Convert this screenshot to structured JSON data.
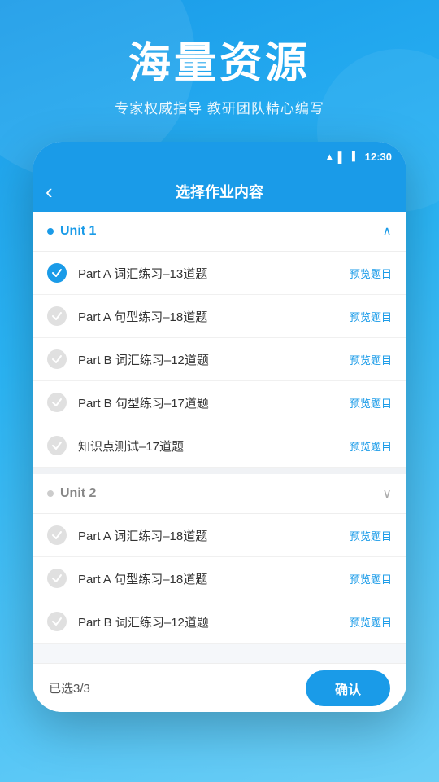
{
  "hero": {
    "title": "海量资源",
    "subtitle": "专家权威指导 教研团队精心编写"
  },
  "statusBar": {
    "time": "12:30"
  },
  "navBar": {
    "title": "选择作业内容",
    "backIcon": "‹"
  },
  "units": [
    {
      "id": "unit1",
      "label": "Unit 1",
      "expanded": true,
      "active": true,
      "items": [
        {
          "id": "u1i1",
          "text": "Part A 词汇练习–13道题",
          "checked": true,
          "previewLabel": "预览题目"
        },
        {
          "id": "u1i2",
          "text": "Part A 句型练习–18道题",
          "checked": false,
          "previewLabel": "预览题目"
        },
        {
          "id": "u1i3",
          "text": "Part B 词汇练习–12道题",
          "checked": false,
          "previewLabel": "预览题目"
        },
        {
          "id": "u1i4",
          "text": "Part B 句型练习–17道题",
          "checked": false,
          "previewLabel": "预览题目"
        },
        {
          "id": "u1i5",
          "text": "知识点测试–17道题",
          "checked": false,
          "previewLabel": "预览题目"
        }
      ]
    },
    {
      "id": "unit2",
      "label": "Unit 2",
      "expanded": true,
      "active": false,
      "items": [
        {
          "id": "u2i1",
          "text": "Part A 词汇练习–18道题",
          "checked": false,
          "previewLabel": "预览题目"
        },
        {
          "id": "u2i2",
          "text": "Part A 句型练习–18道题",
          "checked": false,
          "previewLabel": "预览题目"
        },
        {
          "id": "u2i3",
          "text": "Part B 词汇练习–12道题",
          "checked": false,
          "previewLabel": "预览题目"
        }
      ]
    }
  ],
  "bottomBar": {
    "selectedCount": "已选3/3",
    "confirmLabel": "确认"
  }
}
